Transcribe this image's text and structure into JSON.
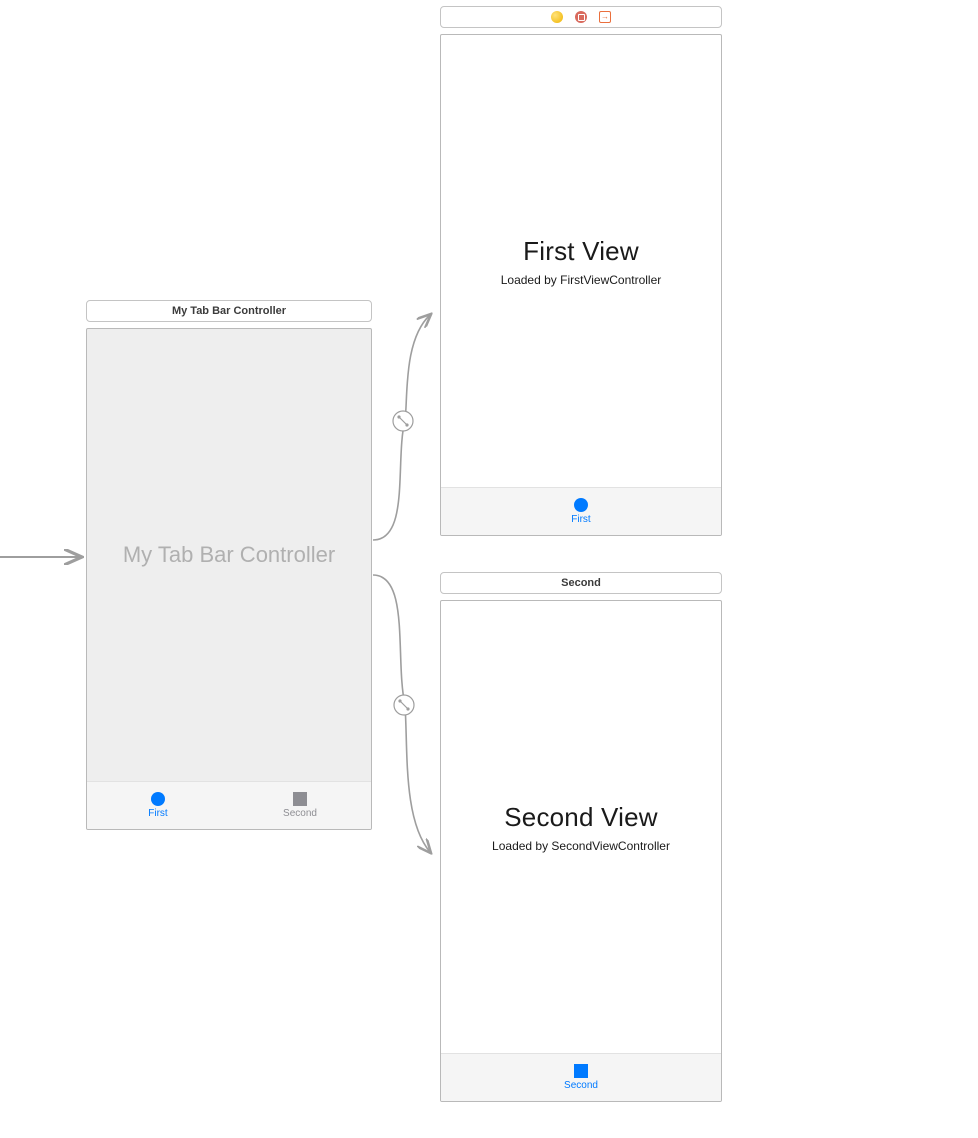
{
  "tabbar_scene": {
    "title": "My Tab Bar Controller",
    "placeholder": "My Tab Bar Controller",
    "tabs": [
      {
        "label": "First"
      },
      {
        "label": "Second"
      }
    ]
  },
  "first_scene": {
    "heading": "First View",
    "subtitle": "Loaded by FirstViewController",
    "tab_label": "First"
  },
  "second_scene": {
    "title": "Second",
    "heading": "Second View",
    "subtitle": "Loaded by SecondViewController",
    "tab_label": "Second"
  }
}
